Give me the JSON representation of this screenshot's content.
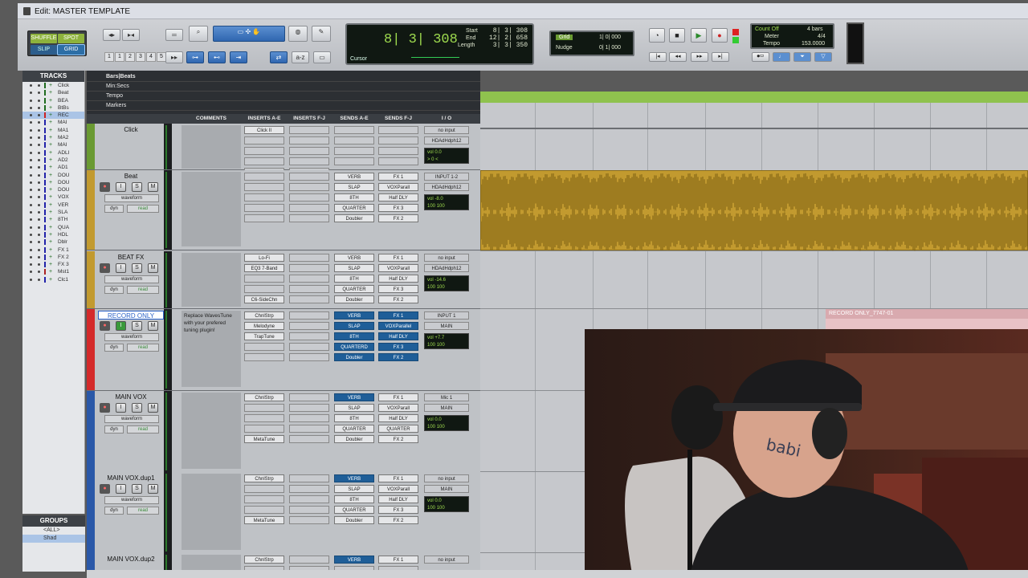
{
  "window": {
    "title": "Edit: MASTER TEMPLATE"
  },
  "toolbar": {
    "modes": [
      "SHUFFLE",
      "SPOT",
      "SLIP",
      "GRID"
    ],
    "zoom_presets": [
      "1",
      "2",
      "3",
      "4",
      "5"
    ],
    "counter": {
      "main": "8| 3| 308",
      "cursor_label": "Cursor",
      "start_label": "Start",
      "end_label": "End",
      "length_label": "Length",
      "start": "8| 3| 308",
      "end": "12| 2| 658",
      "length": "3| 3| 350"
    },
    "grid_label": "Grid",
    "grid_value": "1| 0| 000",
    "nudge_label": "Nudge",
    "nudge_value": "0| 1| 000",
    "count_off": "Count Off",
    "bars": "4 bars",
    "meter_label": "Meter",
    "meter": "4/4",
    "tempo_label": "Tempo",
    "tempo": "153.0000"
  },
  "tracklist": {
    "header": "TRACKS",
    "items": [
      "Click",
      "Beat",
      "BEA",
      "BtBs",
      "REC",
      "MAI",
      "MA1",
      "MA2",
      "MAI",
      "ADLI",
      "AD2",
      "AD1",
      "DOU",
      "DOU",
      "DOU",
      "VOX",
      "VER",
      "SLA",
      "8TH",
      "QUA",
      "HDL",
      "Dblr",
      "FX 1",
      "FX 2",
      "FX 3",
      "Mst1",
      "Clc1"
    ]
  },
  "groups": {
    "header": "GROUPS",
    "items": [
      "<ALL>",
      "Shad"
    ]
  },
  "rulers": {
    "bars": "Bars|Beats",
    "min": "Min:Secs",
    "tempo": "Tempo",
    "markers": "Markers"
  },
  "columns": [
    "COMMENTS",
    "INSERTS A-E",
    "INSERTS F-J",
    "SENDS A-E",
    "SENDS F-J",
    "I / O"
  ],
  "tracks": [
    {
      "name": "Click",
      "inserts": [
        "Click II"
      ],
      "sends": [],
      "sendsfj": [],
      "io_in": "no input",
      "io_out": "HDAdHdph12",
      "vol": "0.0",
      "pan": "> 0 <"
    },
    {
      "name": "Beat",
      "waveform": "waveform",
      "dyn": "dyn",
      "read": "read",
      "inserts": [],
      "sends": [
        "VERB",
        "SLAP",
        "8TH",
        "QUARTER",
        "Doubler"
      ],
      "sendsfj": [
        "FX 1",
        "VOXParall",
        "Half DLY",
        "FX 3",
        "FX 2"
      ],
      "io_in": "INPUT 1-2",
      "io_out": "HDAdHdph12",
      "vol": "-8.0",
      "pan": "100",
      "pan2": "100"
    },
    {
      "name": "BEAT FX",
      "waveform": "waveform",
      "dyn": "dyn",
      "read": "read",
      "inserts": [
        "Lo-Fi",
        "EQ3 7-Band",
        "",
        "",
        "C6-SideChn"
      ],
      "sends": [
        "VERB",
        "SLAP",
        "8TH",
        "QUARTER",
        "Doubler"
      ],
      "sendsfj": [
        "FX 1",
        "VOXParall",
        "Half DLY",
        "FX 3",
        "FX 2"
      ],
      "io_in": "no input",
      "io_out": "HDAdHdph12",
      "vol": "-14.6",
      "pan": "100",
      "pan2": "100"
    },
    {
      "name": "RECORD ONLY",
      "comment": "Replace WavesTune with your prefered tuning plugin!",
      "waveform": "waveform",
      "dyn": "dyn",
      "read": "read",
      "inserts": [
        "ChnlStrp",
        "Melodyne",
        "TrapTune"
      ],
      "sends": [
        "VERB",
        "SLAP",
        "8TH",
        "QUARTERD",
        "Doubler"
      ],
      "sendsfj": [
        "FX 1",
        "VOXParallel",
        "Half DLY",
        "FX 3",
        "FX 2"
      ],
      "io_in": "INPUT 1",
      "io_out": "MAIN",
      "vol": "+7.7",
      "pan": "100",
      "pan2": "100"
    },
    {
      "name": "MAIN VOX",
      "waveform": "waveform",
      "dyn": "dyn",
      "read": "read",
      "inserts": [
        "ChnlStrp",
        "",
        "",
        "",
        "MetaTune"
      ],
      "sends": [
        "VERB",
        "SLAP",
        "8TH",
        "QUARTER",
        "Doubler"
      ],
      "sendsfj": [
        "FX 1",
        "VOXParall",
        "Half DLY",
        "QUARTER",
        "FX 2"
      ],
      "io_in": "Mic 1",
      "io_out": "MAIN",
      "vol": "0.0",
      "pan": "100",
      "pan2": "100"
    },
    {
      "name": "MAIN VOX.dup1",
      "waveform": "waveform",
      "dyn": "dyn",
      "read": "read",
      "inserts": [
        "ChnlStrp",
        "",
        "",
        "",
        "MetaTune"
      ],
      "sends": [
        "VERB",
        "SLAP",
        "8TH",
        "QUARTER",
        "Doubler"
      ],
      "sendsfj": [
        "FX 1",
        "VOXParall",
        "Half DLY",
        "FX 3",
        "FX 2"
      ],
      "io_in": "no input",
      "io_out": "MAIN",
      "vol": "0.0",
      "pan": "100",
      "pan2": "100"
    },
    {
      "name": "MAIN VOX.dup2",
      "inserts": [
        "ChnlStrp"
      ],
      "sends": [
        "VERB"
      ],
      "sendsfj": [
        "FX 1"
      ],
      "io_in": "no input"
    }
  ],
  "send_letters": [
    "a",
    "b",
    "c",
    "d",
    "e"
  ],
  "sendfj_letters": [
    "f",
    "g",
    "h",
    "i",
    "j"
  ],
  "clip_label": "RECORD ONLY_7747-01",
  "colors": {
    "beat_clip": "#c29a2f",
    "record_track": "#d42a2a",
    "blue_track": "#2a58a8",
    "green_track": "#6a9a32"
  }
}
